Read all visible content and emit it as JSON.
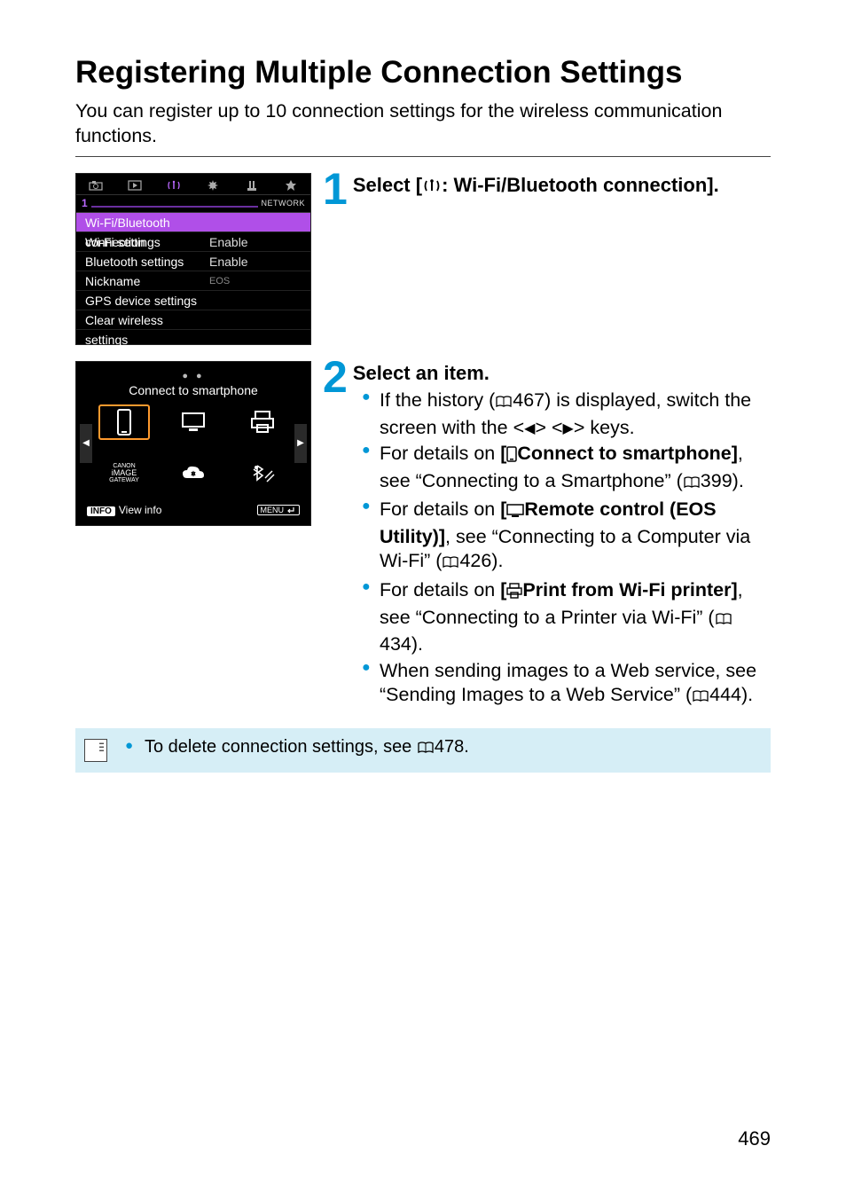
{
  "title": "Registering Multiple Connection Settings",
  "intro": "You can register up to 10 connection settings for the wireless communication functions.",
  "step1": {
    "num": "1",
    "title_before": "Select [",
    "title_after": ": Wi-Fi/Bluetooth connection]."
  },
  "step2": {
    "num": "2",
    "title": "Select an item.",
    "b1a": "If the history (",
    "b1b": "467) is displayed, switch the screen with the <",
    "b1c": "> <",
    "b1d": "> keys.",
    "b2a": "For details on ",
    "b2b": "[",
    "b2c": "Connect to smartphone]",
    "b2d": ", see “Connecting to a Smartphone” (",
    "b2e": "399).",
    "b3a": "For details on ",
    "b3b": "[",
    "b3c": "Remote control (EOS Utility)]",
    "b3d": ", see “Connecting to a Computer via Wi-Fi” (",
    "b3e": "426).",
    "b4a": "For details on ",
    "b4b": "[",
    "b4c": "Print from Wi-Fi printer]",
    "b4d": ", see “Connecting to a Printer via Wi-Fi” (",
    "b4e": "434).",
    "b5a": "When sending images to a Web service, see “Sending Images to a Web Service” (",
    "b5b": "444)."
  },
  "note": {
    "a": "To delete connection settings, see ",
    "b": "478."
  },
  "lcd1": {
    "pgnum": "1",
    "netlabel": "NETWORK",
    "rows": [
      {
        "k": "Wi-Fi/Bluetooth connection",
        "v": "",
        "sel": true
      },
      {
        "k": "Wi-Fi settings",
        "v": "Enable"
      },
      {
        "k": "Bluetooth settings",
        "v": "Enable"
      },
      {
        "k": "Nickname",
        "v": "EOS"
      },
      {
        "k": "GPS device settings",
        "v": ""
      },
      {
        "k": "Clear wireless settings",
        "v": ""
      }
    ]
  },
  "lcd2": {
    "title": "Connect to smartphone",
    "info_label": "INFO",
    "view_info": "View info",
    "menu_label": "MENU",
    "gateway1": "CANON",
    "gateway2": "iMAGE",
    "gateway3": "GATEWAY"
  },
  "page_number": "469"
}
